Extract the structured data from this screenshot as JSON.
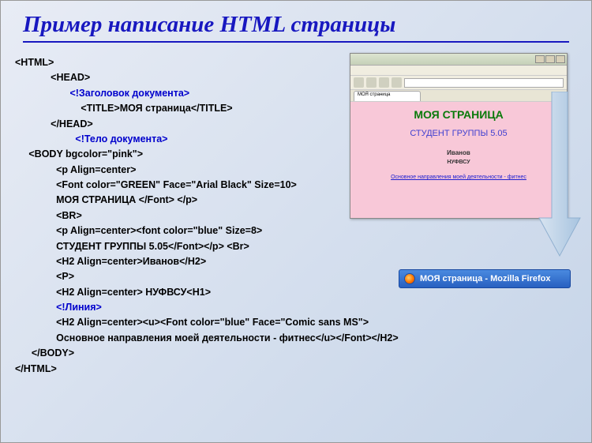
{
  "title": "Пример написание HTML страницы",
  "code": {
    "l1": "<HTML>",
    "l2": "<HEAD>",
    "l3": "<!Заголовок документа>",
    "l4a": "<TITLE>",
    "l4b": "МОЯ страница",
    "l4c": "</TITLE>",
    "l5": "</HEAD>",
    "l6": "<!Тело документа>",
    "l7": "<BODY bgcolor=\"pink\">",
    "l8": "<p Align=center>",
    "l9": "<Font color=\"GREEN\" Face=\"Arial Black\" Size=10>",
    "l10a": "МОЯ СТРАНИЦА",
    "l10b": " </Font> </p>",
    "l11": "<BR>",
    "l12": "<p Align=center><font color=\"blue\" Size=8>",
    "l13a": "СТУДЕНТ ГРУППЫ 5.05",
    "l13b": "</Font></p> <Br>",
    "l14a": "<H2 Align=center>",
    "l14b": "Иванов",
    "l14c": "</H2>",
    "l15": "<P>",
    "l16a": "<H2 Align=center>",
    "l16b": " НУФВСУ",
    "l16c": "<H1>",
    "l17": "<!Линия>",
    "l18": "<H2 Align=center><u><Font color=\"blue\" Face=\"Comic sans MS\">",
    "l19a": "Основное направления моей деятельности - фитнес",
    "l19b": "</u></Font></H2>",
    "l20": "</BODY>",
    "l21": "</HTML>"
  },
  "browser": {
    "tab": "МОЯ страница",
    "h1": "МОЯ СТРАНИЦА",
    "h2": "СТУДЕНТ ГРУППЫ 5.05",
    "h3": "Иванов",
    "h4": "НУФВСУ",
    "link": "Основное направления моей деятельности -   фитнес"
  },
  "taskbar": {
    "label": "МОЯ страница - Mozilla Firefox"
  }
}
